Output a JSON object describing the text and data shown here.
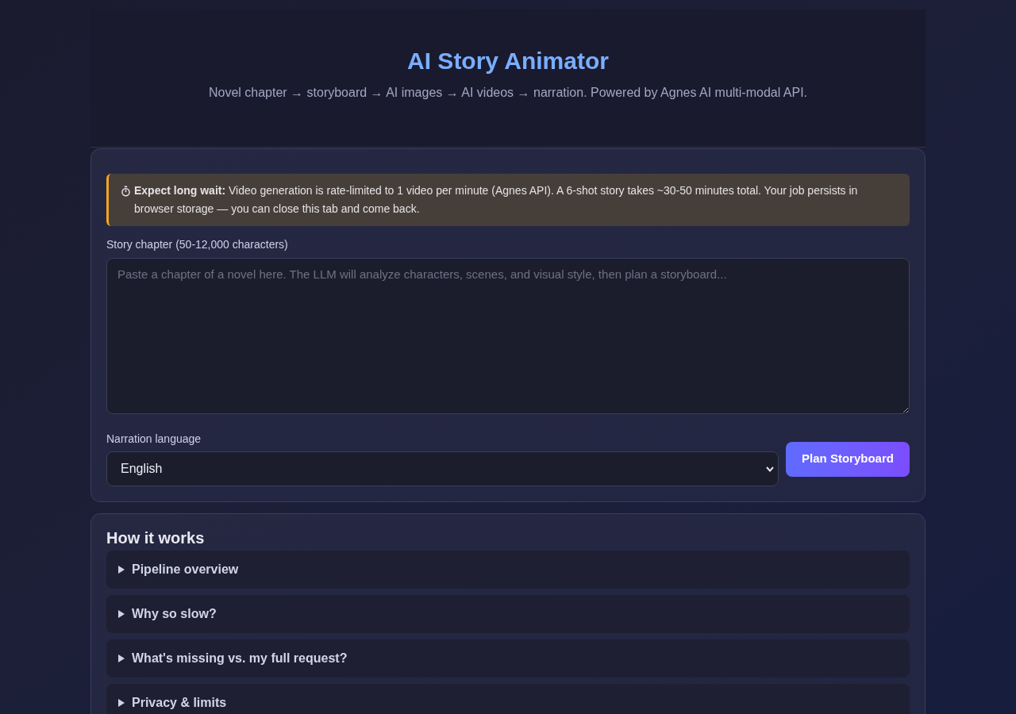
{
  "header": {
    "title": "AI Story Animator",
    "subtitle": "Novel chapter → storyboard → AI images → AI videos → narration. Powered by Agnes AI multi-modal API."
  },
  "input_card": {
    "notice": {
      "text": "**Expect long wait:** Video generation is rate-limited to 1 video per minute (Agnes API). A 6-shot story takes ~30-50 minutes total. Your job persists in browser storage — you can close this tab and come back."
    },
    "chapter_field": {
      "label": "Story chapter (50-12,000 characters)",
      "placeholder": "Paste a chapter of a novel here. The LLM will analyze characters, scenes, and visual style, then plan a storyboard..."
    },
    "language_field": {
      "label": "Narration language",
      "value": "English"
    },
    "submit_button": {
      "label": "Plan Storyboard"
    }
  },
  "how_it_works": {
    "title": "How it works",
    "items": [
      {
        "title": "Pipeline overview",
        "expanded": false
      },
      {
        "title": "Why so slow?",
        "expanded": false
      },
      {
        "title": "What's missing vs. my full request?",
        "expanded": false
      },
      {
        "title": "Privacy & limits",
        "expanded": false
      }
    ]
  }
}
